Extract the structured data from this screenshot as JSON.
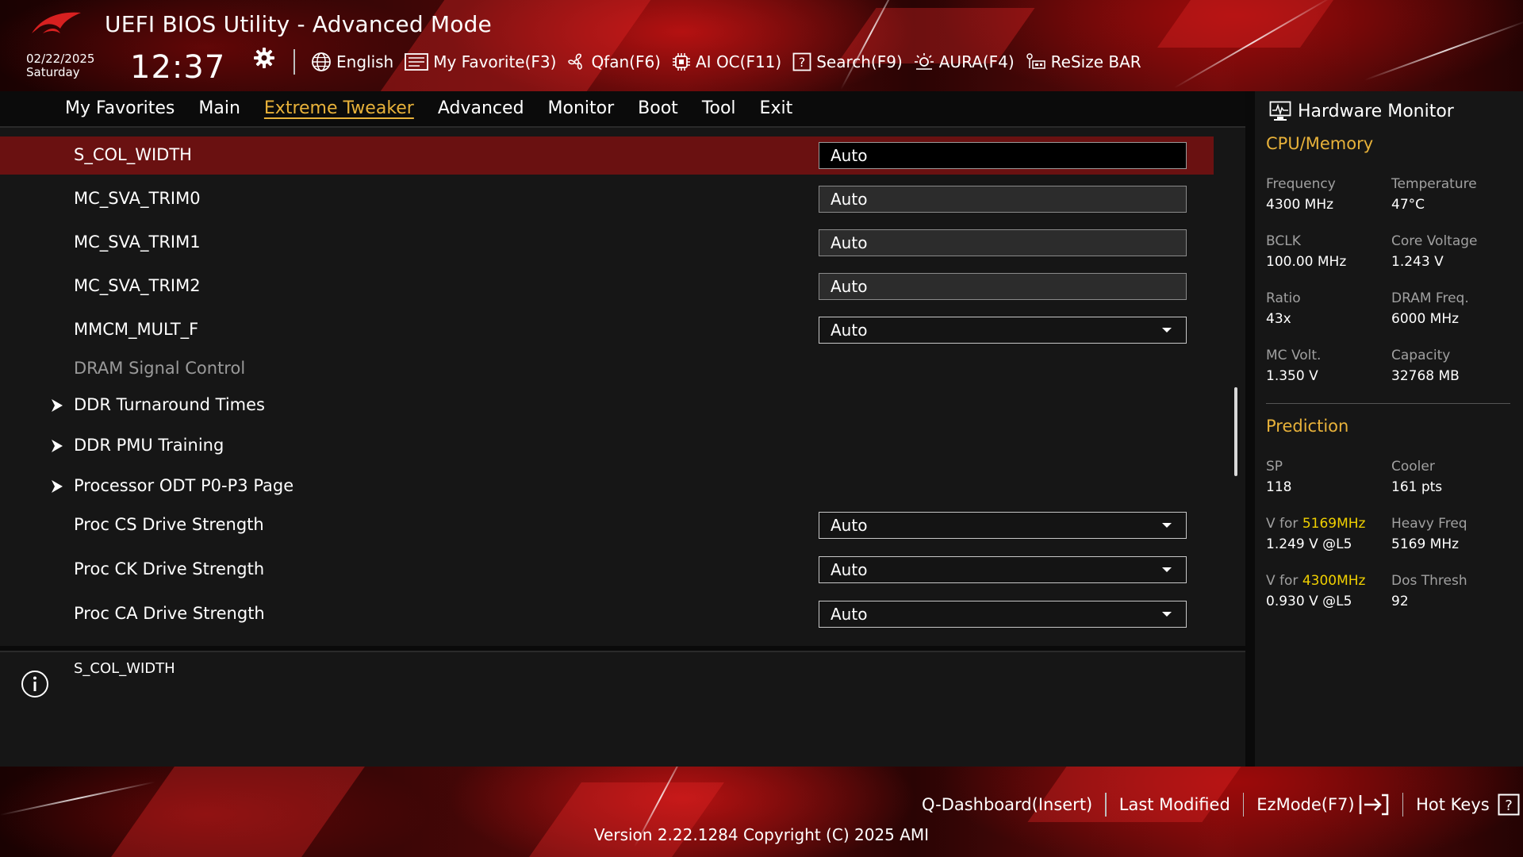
{
  "header": {
    "title": "UEFI BIOS Utility - Advanced Mode",
    "date": "02/22/2025",
    "day": "Saturday",
    "time": "12:37",
    "toolbar": [
      {
        "id": "language",
        "label": "English",
        "icon": "globe-icon"
      },
      {
        "id": "my-favorite",
        "label": "My Favorite(F3)",
        "icon": "favorite-list-icon"
      },
      {
        "id": "qfan",
        "label": "Qfan(F6)",
        "icon": "fan-icon"
      },
      {
        "id": "ai-oc",
        "label": "AI OC(F11)",
        "icon": "chip-icon"
      },
      {
        "id": "search",
        "label": "Search(F9)",
        "icon": "question-box-icon"
      },
      {
        "id": "aura",
        "label": "AURA(F4)",
        "icon": "aura-light-icon"
      },
      {
        "id": "resize-bar",
        "label": "ReSize BAR",
        "icon": "resize-bar-icon"
      }
    ]
  },
  "tabs": [
    {
      "label": "My Favorites",
      "active": false
    },
    {
      "label": "Main",
      "active": false
    },
    {
      "label": "Extreme Tweaker",
      "active": true
    },
    {
      "label": "Advanced",
      "active": false
    },
    {
      "label": "Monitor",
      "active": false
    },
    {
      "label": "Boot",
      "active": false
    },
    {
      "label": "Tool",
      "active": false
    },
    {
      "label": "Exit",
      "active": false
    }
  ],
  "settings": [
    {
      "label": "S_COL_WIDTH",
      "value": "Auto",
      "kind": "field",
      "selected": true
    },
    {
      "label": "MC_SVA_TRIM0",
      "value": "Auto",
      "kind": "field"
    },
    {
      "label": "MC_SVA_TRIM1",
      "value": "Auto",
      "kind": "field"
    },
    {
      "label": "MC_SVA_TRIM2",
      "value": "Auto",
      "kind": "field"
    },
    {
      "label": "MMCM_MULT_F",
      "value": "Auto",
      "kind": "dropdown"
    },
    {
      "label": "DRAM Signal Control",
      "kind": "section"
    },
    {
      "label": "DDR Turnaround Times",
      "kind": "submenu"
    },
    {
      "label": "DDR PMU Training",
      "kind": "submenu"
    },
    {
      "label": "Processor ODT P0-P3 Page",
      "kind": "submenu"
    },
    {
      "label": "Proc CS Drive Strength",
      "value": "Auto",
      "kind": "dropdown"
    },
    {
      "label": "Proc CK Drive Strength",
      "value": "Auto",
      "kind": "dropdown"
    },
    {
      "label": "Proc CA Drive Strength",
      "value": "Auto",
      "kind": "dropdown"
    }
  ],
  "info": {
    "text": "S_COL_WIDTH"
  },
  "hw_monitor": {
    "title": "Hardware Monitor",
    "cpu_memory": {
      "title": "CPU/Memory",
      "items": [
        {
          "label": "Frequency",
          "value": "4300 MHz"
        },
        {
          "label": "Temperature",
          "value": "47°C"
        },
        {
          "label": "BCLK",
          "value": "100.00 MHz"
        },
        {
          "label": "Core Voltage",
          "value": "1.243 V"
        },
        {
          "label": "Ratio",
          "value": "43x"
        },
        {
          "label": "DRAM Freq.",
          "value": "6000 MHz"
        },
        {
          "label": "MC Volt.",
          "value": "1.350 V"
        },
        {
          "label": "Capacity",
          "value": "32768 MB"
        }
      ]
    },
    "prediction": {
      "title": "Prediction",
      "items": [
        {
          "label": "SP",
          "value": "118"
        },
        {
          "label": "Cooler",
          "value": "161 pts"
        },
        {
          "label_prefix": "V for ",
          "label_highlight": "5169MHz",
          "value": "1.249 V @L5"
        },
        {
          "label": "Heavy Freq",
          "value": "5169 MHz"
        },
        {
          "label_prefix": "V for ",
          "label_highlight": "4300MHz",
          "value": "0.930 V @L5"
        },
        {
          "label": "Dos Thresh",
          "value": "92"
        }
      ]
    }
  },
  "footer": {
    "actions": [
      {
        "id": "q-dashboard",
        "label": "Q-Dashboard(Insert)"
      },
      {
        "id": "last-modified",
        "label": "Last Modified"
      },
      {
        "id": "ezmode",
        "label": "EzMode(F7)"
      },
      {
        "id": "hot-keys",
        "label": "Hot Keys"
      }
    ],
    "version": "Version 2.22.1284 Copyright (C) 2025 AMI"
  },
  "colors": {
    "accent_gold": "#e8b23a",
    "highlight_yellow": "#f0d000",
    "selected_row": "#6a1111",
    "panel_bg": "#161616"
  }
}
